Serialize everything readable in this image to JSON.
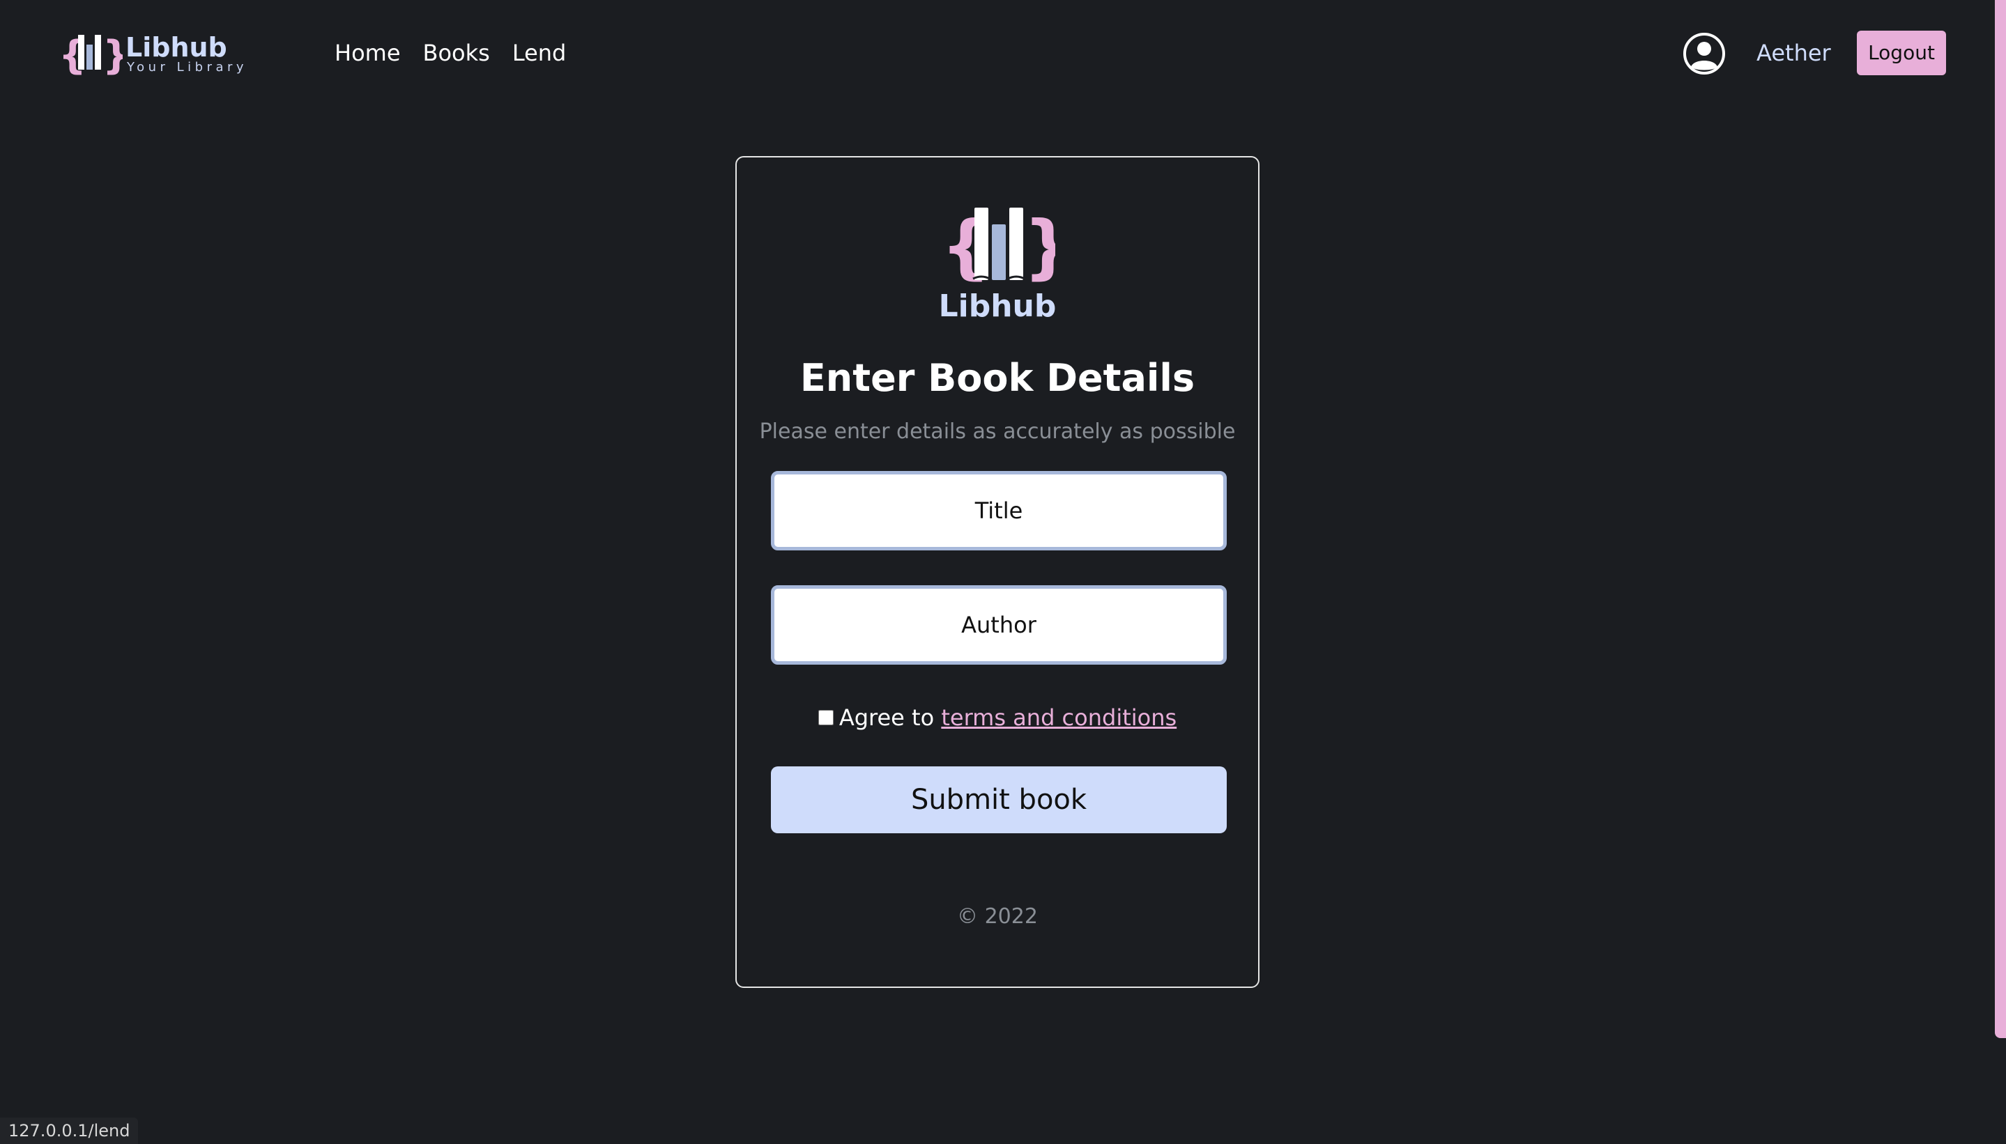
{
  "brand": {
    "name": "Libhub",
    "tagline": "Your Library",
    "logo_icon": "libhub-books-braces-logo",
    "colors": {
      "accent_pink": "#e8afd9",
      "accent_blue": "#cfdcfb",
      "background": "#1b1d21"
    }
  },
  "nav": {
    "links": [
      {
        "label": "Home"
      },
      {
        "label": "Books"
      },
      {
        "label": "Lend"
      }
    ],
    "user_icon": "user-circle-icon",
    "user_name": "Aether",
    "logout_label": "Logout"
  },
  "form": {
    "logo_text": "Libhub",
    "title": "Enter Book Details",
    "subtitle": "Please enter details as accurately as possible",
    "title_field": {
      "placeholder": "Title",
      "value": ""
    },
    "author_field": {
      "placeholder": "Author",
      "value": ""
    },
    "agree": {
      "checked": false,
      "prefix": "Agree to ",
      "link_label": "terms and conditions"
    },
    "submit_label": "Submit book",
    "copyright": "© 2022"
  },
  "status_bar": {
    "url": "127.0.0.1/lend"
  }
}
